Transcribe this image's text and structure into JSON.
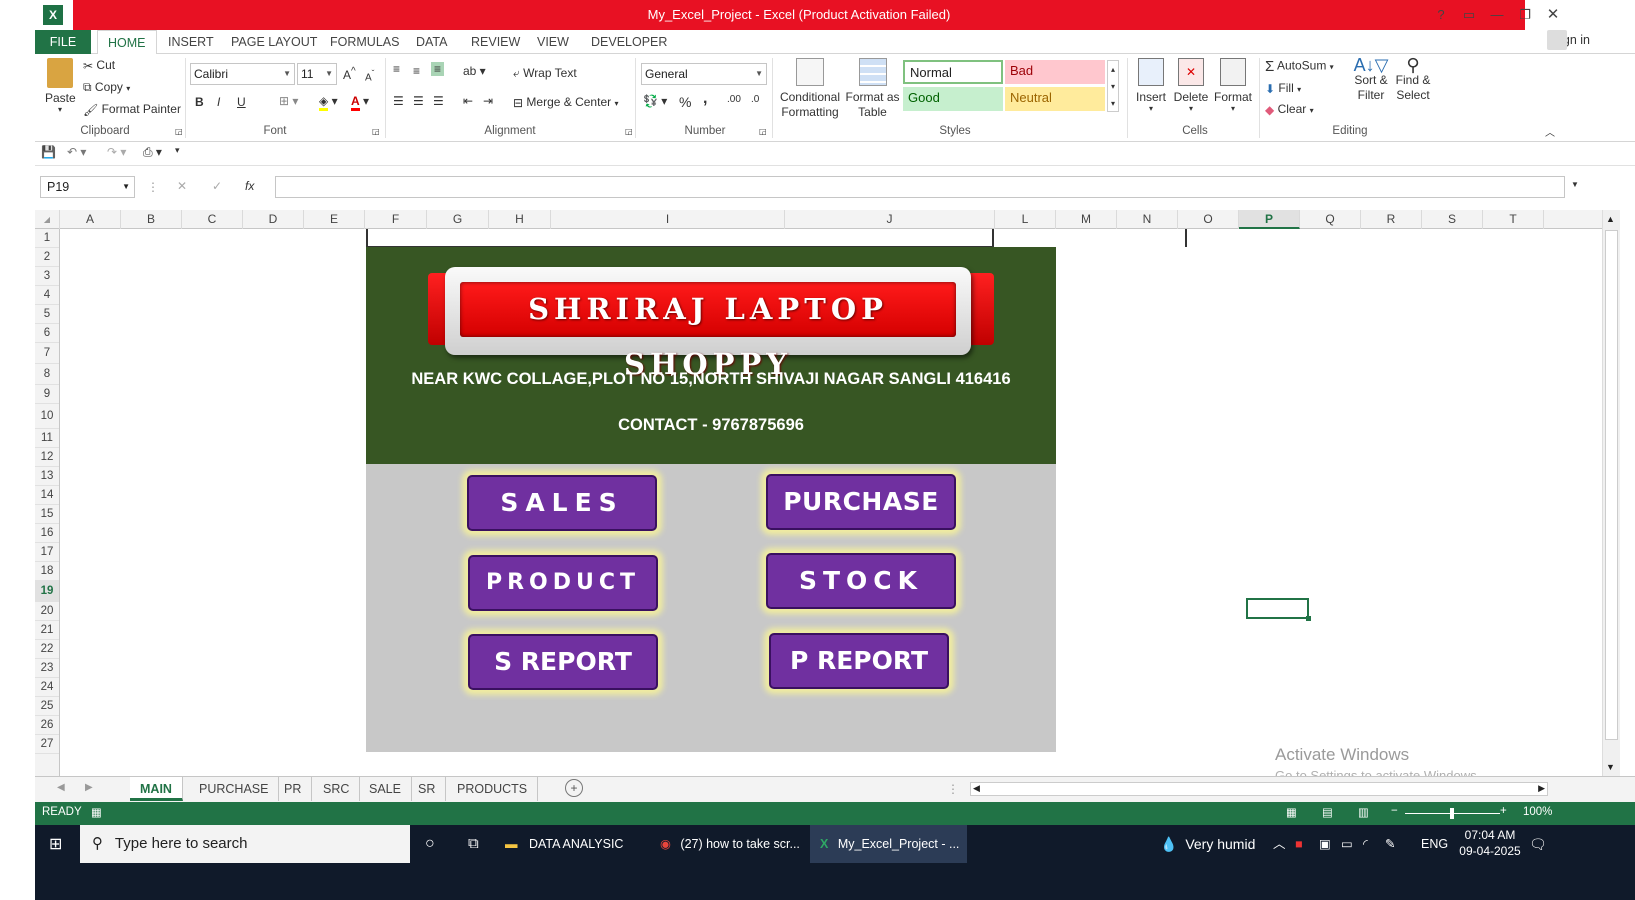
{
  "window": {
    "title": "My_Excel_Project -  Excel (Product Activation Failed)",
    "help": "?",
    "sign_in": "Sign in"
  },
  "ribbon_tabs": [
    "FILE",
    "HOME",
    "INSERT",
    "PAGE LAYOUT",
    "FORMULAS",
    "DATA",
    "REVIEW",
    "VIEW",
    "DEVELOPER"
  ],
  "clipboard": {
    "paste": "Paste",
    "cut": "Cut",
    "copy": "Copy",
    "format_painter": "Format Painter",
    "label": "Clipboard"
  },
  "font": {
    "name": "Calibri",
    "size": "11",
    "bold": "B",
    "italic": "I",
    "underline": "U",
    "label": "Font"
  },
  "alignment": {
    "wrap_text": "Wrap Text",
    "merge_center": "Merge & Center",
    "label": "Alignment"
  },
  "number": {
    "format": "General",
    "percent": "%",
    "comma": ",",
    "label": "Number"
  },
  "styles": {
    "conditional_formatting": "Conditional Formatting",
    "format_as_table": "Format as Table",
    "normal": "Normal",
    "bad": "Bad",
    "good": "Good",
    "neutral": "Neutral",
    "label": "Styles"
  },
  "cells": {
    "insert": "Insert",
    "delete": "Delete",
    "format": "Format",
    "label": "Cells"
  },
  "editing": {
    "autosum": "AutoSum",
    "fill": "Fill",
    "clear": "Clear",
    "sort_filter": "Sort & Filter",
    "find_select": "Find & Select",
    "label": "Editing"
  },
  "formula_bar": {
    "name_box": "P19",
    "fx": "fx",
    "value": ""
  },
  "columns": [
    "A",
    "B",
    "C",
    "D",
    "E",
    "F",
    "G",
    "H",
    "I",
    "J",
    "L",
    "M",
    "N",
    "O",
    "P",
    "Q",
    "R",
    "S",
    "T"
  ],
  "rows": [
    "1",
    "2",
    "3",
    "4",
    "5",
    "6",
    "7",
    "8",
    "9",
    "10",
    "11",
    "12",
    "13",
    "14",
    "15",
    "16",
    "17",
    "18",
    "19",
    "20",
    "21",
    "22",
    "23",
    "24",
    "25",
    "26",
    "27"
  ],
  "dashboard": {
    "shop_name": "SHRIRAJ LAPTOP SHOPPY",
    "address": "NEAR KWC COLLAGE,PLOT NO 15,NORTH SHIVAJI NAGAR SANGLI  416416",
    "contact": "CONTACT - 9767875696",
    "buttons": {
      "sales": "SALES",
      "purchase": "PURCHASE",
      "product": "PRODUCT",
      "stock": "STOCK",
      "s_report": "S REPORT",
      "p_report": "P REPORT"
    }
  },
  "watermark": {
    "line1": "Activate Windows",
    "line2": "Go to Settings to activate Windows."
  },
  "sheet_tabs": [
    "MAIN",
    "PURCHASE",
    "PR",
    "SRC",
    "SALE",
    "SR",
    "PRODUCTS"
  ],
  "active_sheet": "MAIN",
  "status": {
    "ready": "READY",
    "zoom": "100%"
  },
  "taskbar": {
    "search_placeholder": "Type here to search",
    "folder": "DATA ANALYSIC",
    "chrome": "(27) how to take scr...",
    "excel": "My_Excel_Project - ...",
    "weather": "Very humid",
    "lang": "ENG",
    "time": "07:04 AM",
    "date": "09-04-2025"
  },
  "colors": {
    "excel_green": "#217346",
    "title_red": "#e81123",
    "dash_green": "#375623",
    "button_purple": "#7030a0"
  }
}
